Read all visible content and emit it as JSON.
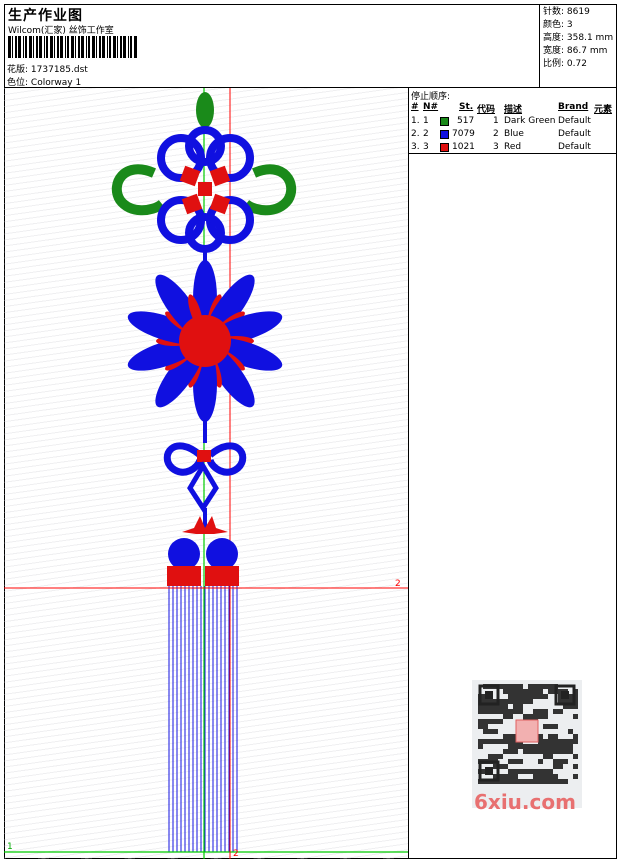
{
  "header": {
    "title": "生产作业图",
    "studio": "Wilcom(汇家) 丝饰工作室",
    "file_label": "花版:",
    "file_name": "1737185.dst",
    "colorway_label": "色位:",
    "colorway_name": "Colorway 1"
  },
  "stats": [
    {
      "label": "针数:",
      "value": "8619"
    },
    {
      "label": "颜色:",
      "value": "3"
    },
    {
      "label": "高度:",
      "value": "358.1 mm"
    },
    {
      "label": "宽度:",
      "value": "86.7 mm"
    },
    {
      "label": "比例:",
      "value": "0.72"
    }
  ],
  "stop_sequence": {
    "title": "停止顺序:",
    "columns": [
      "#",
      "N#",
      "St.",
      "代码",
      "描述",
      "Brand",
      "元素"
    ],
    "rows": [
      {
        "index": "1.",
        "n": "1",
        "color": "#1a8a1a",
        "stitches": "517",
        "code": "1",
        "description": "Dark Green",
        "brand": "Default"
      },
      {
        "index": "2.",
        "n": "2",
        "color": "#1010e0",
        "stitches": "7079",
        "code": "2",
        "description": "Blue",
        "brand": "Default"
      },
      {
        "index": "3.",
        "n": "3",
        "color": "#e01010",
        "stitches": "1021",
        "code": "3",
        "description": "Red",
        "brand": "Default"
      }
    ]
  },
  "canvas": {
    "marker_green": "1",
    "marker_red_h": "2",
    "marker_red_v": "2"
  },
  "watermark": "6xiu.com",
  "colors": {
    "green": "#1a8a1a",
    "blue": "#1010e0",
    "red": "#e01010",
    "guide_green": "#00cc00",
    "guide_red": "#ff0000"
  }
}
